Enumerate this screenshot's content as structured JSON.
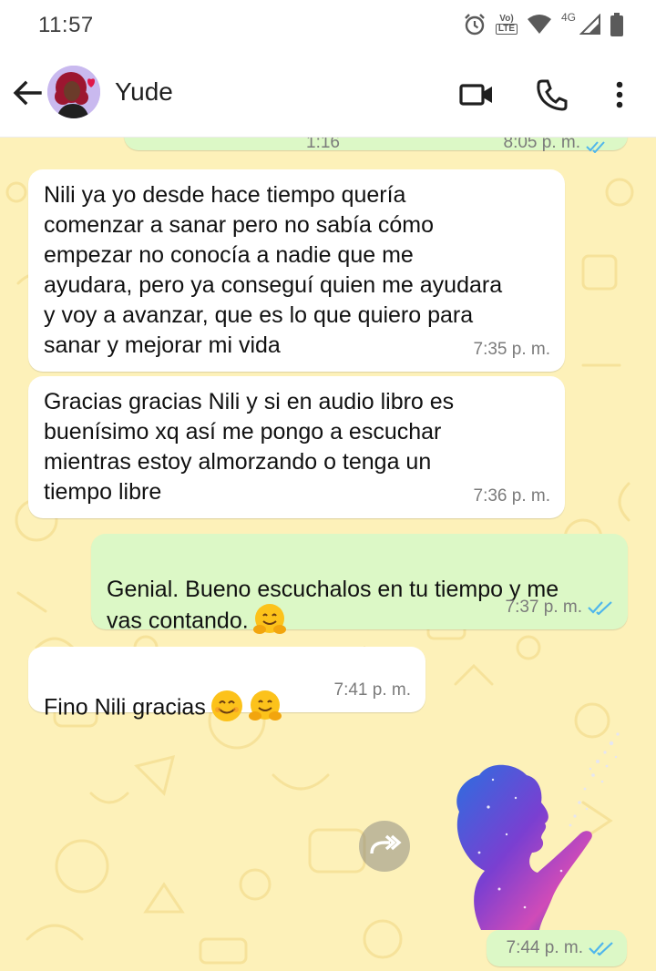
{
  "status_bar": {
    "time": "11:57",
    "volte_label_top": "Vo)",
    "volte_label_bottom": "LTE",
    "network_label": "4G",
    "icons": [
      "alarm-icon",
      "volte-icon",
      "wifi-icon",
      "signal-icon",
      "battery-icon"
    ]
  },
  "app_bar": {
    "contact_name": "Yude",
    "icons": [
      "back-arrow-icon",
      "video-call-icon",
      "phone-icon",
      "more-vert-icon"
    ]
  },
  "chat": {
    "partial_top_left": "1:16",
    "partial_top_right": "8:05 p. m.",
    "messages": [
      {
        "direction": "in",
        "text": "Nili ya yo desde hace tiempo quería\ncomenzar a sanar pero no sabía cómo\nempezar no conocía a nadie que me\nayudara, pero ya conseguí quien me ayudara\ny voy a avanzar, que es lo que quiero para\nsanar y mejorar mi vida",
        "time": "7:35 p. m."
      },
      {
        "direction": "in",
        "text": "Gracias gracias Nili y si en audio libro es\nbuenísimo xq así me pongo a escuchar\nmientras estoy almorzando o tenga un\ntiempo libre",
        "time": "7:36 p. m."
      },
      {
        "direction": "out",
        "text": "Genial. Bueno escuchalos en tu tiempo y me\nvas contando.",
        "emoji": [
          "hugging-face-emoji"
        ],
        "time": "7:37 p. m.",
        "status": "read"
      },
      {
        "direction": "in",
        "text": "Fino Nili gracias",
        "emoji": [
          "smiling-face-emoji",
          "hugging-face-emoji"
        ],
        "time": "7:41 p. m."
      },
      {
        "direction": "out",
        "type": "image",
        "image": "woman-galaxy-silhouette-image",
        "time": "7:44 p. m.",
        "status": "read"
      }
    ]
  },
  "colors": {
    "wallpaper": "#fdf1b9",
    "incoming_bubble": "#ffffff",
    "outgoing_bubble": "#dcf8c6",
    "read_ticks": "#4fb6ec",
    "timestamp": "#7b7b7b"
  }
}
